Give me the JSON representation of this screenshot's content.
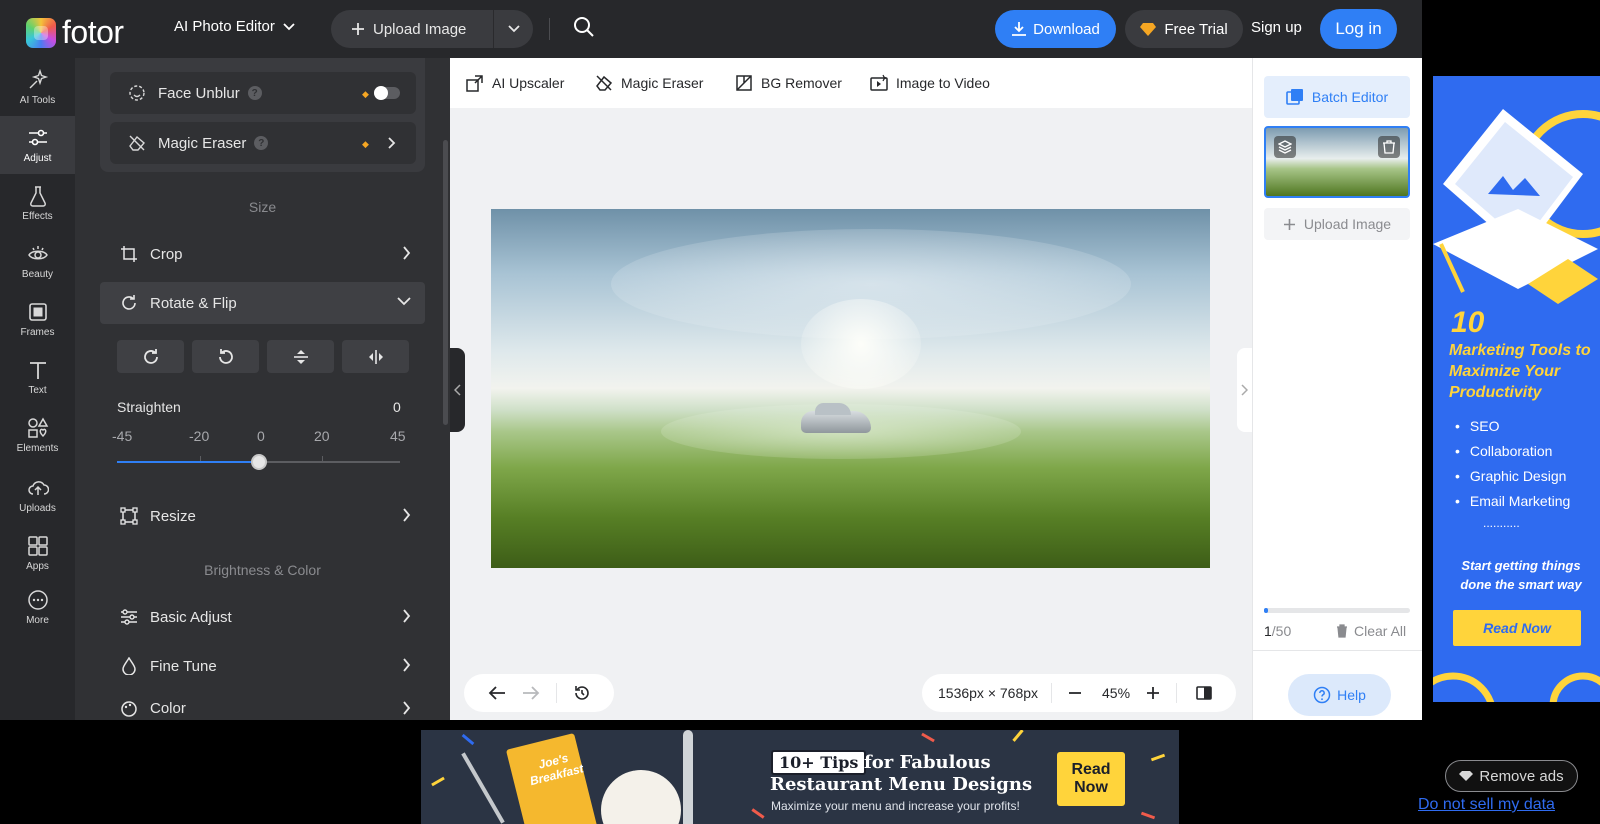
{
  "header": {
    "logo_text": "fotor",
    "editor_menu": "AI Photo Editor",
    "upload_label": "Upload Image",
    "download_label": "Download",
    "trial_label": "Free Trial",
    "signup_label": "Sign up",
    "login_label": "Log in"
  },
  "rail": {
    "items": [
      {
        "label": "AI Tools",
        "icon": "sparkle-icon"
      },
      {
        "label": "Adjust",
        "icon": "sliders-icon",
        "active": true
      },
      {
        "label": "Effects",
        "icon": "flask-icon"
      },
      {
        "label": "Beauty",
        "icon": "eye-icon"
      },
      {
        "label": "Frames",
        "icon": "frame-icon"
      },
      {
        "label": "Text",
        "icon": "text-icon"
      },
      {
        "label": "Elements",
        "icon": "shapes-icon"
      },
      {
        "label": "Uploads",
        "icon": "cloud-upload-icon"
      },
      {
        "label": "Apps",
        "icon": "apps-icon"
      },
      {
        "label": "More",
        "icon": "more-icon"
      }
    ]
  },
  "panel": {
    "face_unblur": "Face Unblur",
    "magic_eraser": "Magic Eraser",
    "section_size": "Size",
    "crop": "Crop",
    "rotate_flip": "Rotate & Flip",
    "straighten_label": "Straighten",
    "straighten_value": "0",
    "ticks": [
      "-45",
      "-20",
      "0",
      "20",
      "45"
    ],
    "resize": "Resize",
    "section_brightness": "Brightness & Color",
    "basic_adjust": "Basic Adjust",
    "fine_tune": "Fine Tune",
    "color": "Color"
  },
  "canvas_toolbar": {
    "upscaler": "AI Upscaler",
    "eraser": "Magic Eraser",
    "bg_remover": "BG Remover",
    "img_to_video": "Image to Video"
  },
  "canvas": {
    "dimensions": "1536px × 768px",
    "zoom": "45%"
  },
  "right_panel": {
    "batch_editor": "Batch Editor",
    "upload_image": "Upload Image",
    "count_current": "1",
    "count_total": "/50",
    "clear_all": "Clear All",
    "help": "Help",
    "progress_fraction": 0.02
  },
  "ad_right": {
    "number": "10",
    "headline": "Marketing Tools to Maximize Your Productivity",
    "items": [
      "SEO",
      "Collaboration",
      "Graphic Design",
      "Email Marketing"
    ],
    "dots": "...........",
    "tagline": "Start getting things done the smart way",
    "cta": "Read Now"
  },
  "ad_bottom": {
    "menu_card": "Joe's Breakfast",
    "tag": "10+ Tips",
    "line1": "for Fabulous",
    "line2": "Restaurant Menu Designs",
    "sub": "Maximize your menu and increase your profits!",
    "cta": "Read Now"
  },
  "footer": {
    "remove_ads": "Remove ads",
    "do_not_sell": "Do not sell my data"
  },
  "colors": {
    "accent": "#2f7ff5",
    "dark_bg": "#27282b",
    "panel_bg": "#303134",
    "premium": "#f5a623"
  }
}
